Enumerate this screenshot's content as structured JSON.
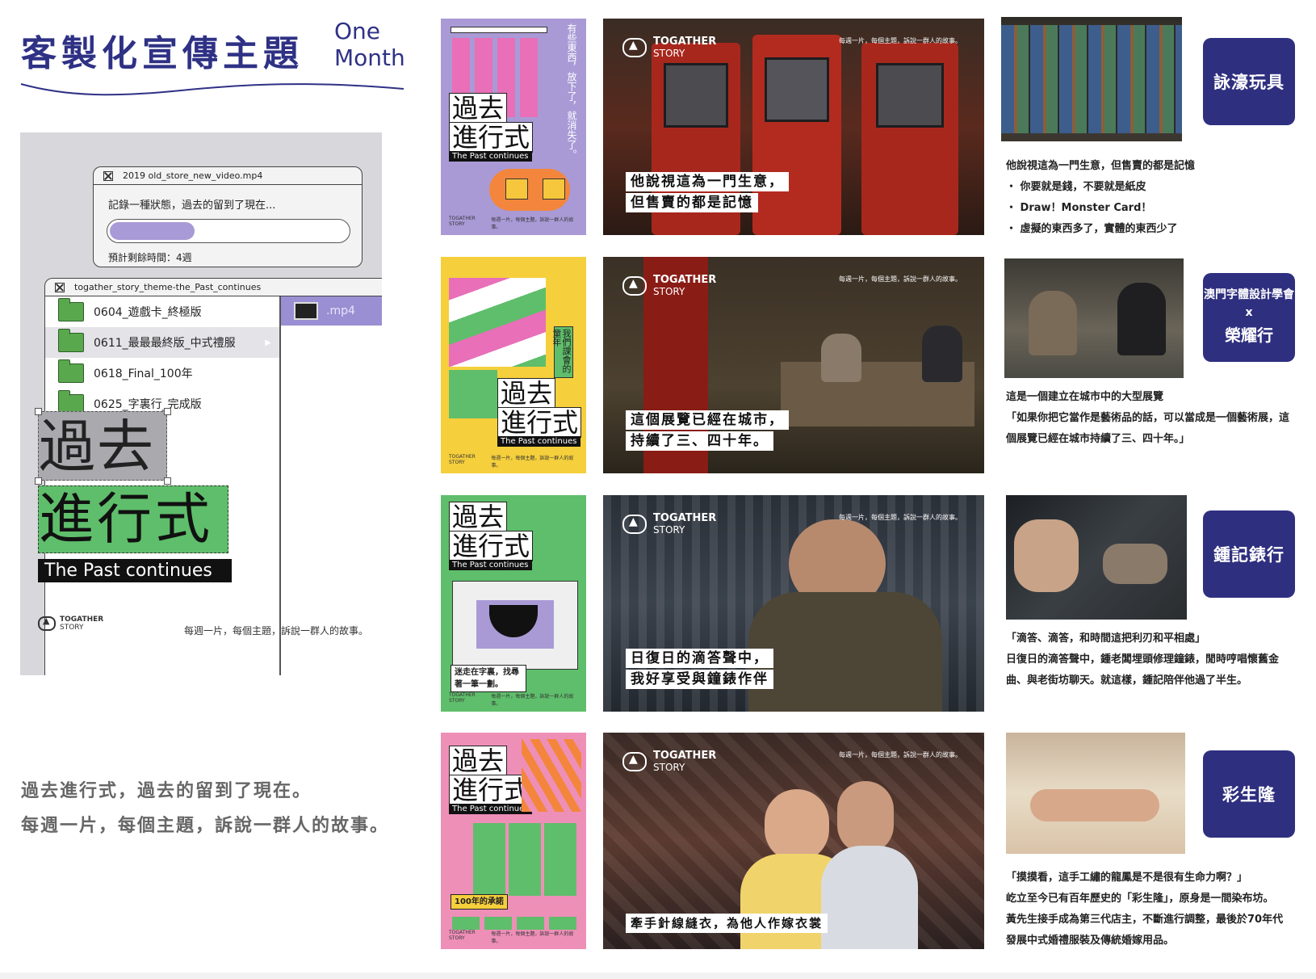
{
  "title": {
    "main": "客製化宣傳主題",
    "sub_line1": "One",
    "sub_line2": "Month"
  },
  "desk": {
    "window1": {
      "filename": "2019 old_store_new_video.mp4",
      "message": "記錄一種狀態，過去的留到了現在...",
      "progress": 0.36,
      "remaining": "預計剩餘時間：4週"
    },
    "window2": {
      "title": "togather_story_theme-the_Past_continues",
      "files": [
        "0604_遊戲卡_終極版",
        "0611_最最最終版_中式禮服",
        "0618_Final_100年",
        "0625_字裏行_完成版"
      ],
      "selected_index": 1,
      "preview_ext": ".mp4"
    },
    "big_line1": "過去",
    "big_line2": "進行式",
    "big_en": "The Past continues",
    "logo_line1": "TOGATHER",
    "logo_line2": "STORY",
    "tagline": "每週一片，每個主題，訴說一群人的故事。"
  },
  "left_copy": {
    "line1": "過去進行式，過去的留到了現在。",
    "line2": "每週一片，每個主題，訴說一群人的故事。"
  },
  "poster": {
    "line1": "過去",
    "line2": "進行式",
    "en": "The Past continues",
    "brand": "TOGATHER STORY",
    "foot": "每週一片，每個主題，訴說一群人的故事。"
  },
  "photo_common": {
    "logo1": "TOGATHER",
    "logo2": "STORY",
    "tag": "每週一片，每個主題，訴說一群人的故事。"
  },
  "rows": [
    {
      "poster_bg": "#a99ad6",
      "poster_callout": "",
      "poster_side_text": "有些東西，放下了，就消失了。",
      "caption1": "他說視這為一門生意，",
      "caption2": "但售賣的都是記憶",
      "badge": "詠濠玩具",
      "desc": [
        "他說視這為一門生意，但售賣的都是記憶",
        "・ 你要就是錢，不要就是紙皮",
        "・ Draw！Monster Card！",
        "・ 虛擬的東西多了，實體的東西少了"
      ]
    },
    {
      "poster_bg": "#f5cf3c",
      "poster_callout": "",
      "poster_side_text": "我們課會的童年",
      "caption1": "這個展覽已經在城市，",
      "caption2": "持續了三、四十年。",
      "badge_line1": "澳門字體設計學會",
      "badge_line2": "x",
      "badge_line3": "榮耀行",
      "desc": [
        "這是一個建立在城市中的大型展覽",
        "「如果你把它當作是藝術品的話，可以當成是一個藝術展，這個展覽已經在城市持續了三、四十年。」"
      ]
    },
    {
      "poster_bg": "#5fbe6b",
      "poster_callout": "迷走在字裏，找尋著一筆一劃。",
      "caption1": "日復日的滴答聲中，",
      "caption2": "我好享受與鐘錶作伴",
      "badge": "鍾記錶行",
      "desc": [
        "「滴答、滴答，和時間這把利刃和平相處」",
        "日復日的滴答聲中，鍾老闆埋頭修理鐘錶，閒時哼唱懷舊金曲、與老街坊聊天。就這樣，鍾記陪伴他過了半生。"
      ]
    },
    {
      "poster_bg": "#ee8fb8",
      "poster_callout": "100年的承諾",
      "caption1": "牽手針線縫衣，為他人作嫁衣裳",
      "caption2": "",
      "badge": "彩生隆",
      "desc": [
        "「摸摸看，這手工繡的龍鳳是不是很有生命力啊？」",
        "屹立至今已有百年歷史的「彩生隆」，原身是一間染布坊。黃先生接手成為第三代店主，不斷進行調整，最後於70年代發展中式婚禮服裝及傳統婚嫁用品。"
      ]
    }
  ]
}
